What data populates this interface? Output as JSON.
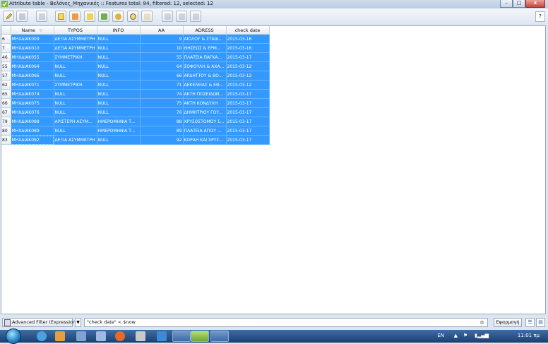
{
  "window": {
    "title": "Attribute table - Βελόνες_Μηχανικές :: Features total: 84, filtered: 12, selected: 12",
    "minimize": "–",
    "maximize": "□",
    "close": "x"
  },
  "toolbar": {
    "buttons": [
      "toggle-editing",
      "save-edits",
      "delete-selected",
      "expression-select",
      "invert-selection",
      "unselect-all",
      "move-selection-top",
      "pan-to-selected",
      "zoom-to-selected",
      "copy-rows",
      "paste-rows",
      "new-column",
      "delete-column",
      "field-calculator"
    ],
    "help": "?"
  },
  "table": {
    "columns": [
      "Name",
      "TYPOS",
      "INFO",
      "AA",
      "ADRESS",
      "check date"
    ],
    "rows": [
      {
        "id": "6",
        "cells": [
          "ΜΗΧΔΙΑΚ009",
          "ΔΕΞΙΑ ΑΣΥΜΜΕΤΡΗ",
          "NULL",
          "9",
          "ΑΙΟΛΟΥ & ΣΤΑΔΙ...",
          "2015-03-16"
        ]
      },
      {
        "id": "7",
        "cells": [
          "ΜΗΧΔΙΑΚ010",
          "ΔΕΞΙΑ ΑΣΥΜΜΕΤΡΗ",
          "NULL",
          "10",
          "ΘΗΣΕΩΣ & ΕΡΜ...",
          "2015-03-16"
        ]
      },
      {
        "id": "46",
        "cells": [
          "ΜΗΧΔΙΑΚ055",
          "ΣΥΜΜΕΤΡΙΚΗ",
          "NULL",
          "55",
          "ΠΛΑΤΕΙΑ ΠΑΓΚΑ...",
          "2015-03-17"
        ]
      },
      {
        "id": "55",
        "cells": [
          "ΜΗΧΔΙΑΚ064",
          "NULL",
          "NULL",
          "64",
          "ΣΟΦΟΥΛΗ & ΑΧΑ...",
          "2015-03-12"
        ]
      },
      {
        "id": "57",
        "cells": [
          "ΜΗΧΔΙΑΚ066",
          "NULL",
          "NULL",
          "66",
          "ΑΡΔΗΤΤΟΥ & ΒΟ...",
          "2015-03-12"
        ]
      },
      {
        "id": "62",
        "cells": [
          "ΜΗΧΔΙΑΚ071",
          "ΣΥΜΜΕΤΡΙΚΗ",
          "NULL",
          "71",
          "ΔΕΚΕΛΕΙΑΣ & ΕΘ...",
          "2015-03-12"
        ]
      },
      {
        "id": "65",
        "cells": [
          "ΜΗΧΔΙΑΚ074",
          "NULL",
          "NULL",
          "74",
          "ΑΚΤΗ ΠΟΣΕΙΔΩΝ...",
          "2015-03-17"
        ]
      },
      {
        "id": "66",
        "cells": [
          "ΜΗΧΔΙΑΚ075",
          "NULL",
          "NULL",
          "75",
          "ΑΚΤΗ ΚΟΝΔΥΛΗ",
          "2015-03-17"
        ]
      },
      {
        "id": "67",
        "cells": [
          "ΜΗΧΔΙΑΚ076",
          "NULL",
          "NULL",
          "76",
          "ΔΗΜΗΤΡΙΟΥ ΓΟΥ...",
          "2015-03-17"
        ]
      },
      {
        "id": "79",
        "cells": [
          "ΜΗΧΔΙΑΚ088",
          "ΑΡΙΣΤΕΡΗ ΑΣΥΜ...",
          "ΗΜΕΡΟΜΗΝΙΑ Τ...",
          "88",
          "ΧΡΥΣΟΣΤΟΜΟΥ Σ...",
          "2015-03-17"
        ]
      },
      {
        "id": "80",
        "cells": [
          "ΜΗΧΔΙΑΚ089",
          "NULL",
          "ΗΜΕΡΟΜΗΝΙΑ Τ...",
          "89",
          "ΠΛΑΤΕΙΑ ΑΓΙΟΥ ...",
          "2015-03-17"
        ]
      },
      {
        "id": "83",
        "cells": [
          "ΜΗΧΔΙΑΚ092",
          "ΔΕΞΙΑ ΑΣΥΜΜΕΤΡΗ",
          "NULL",
          "92",
          "ΚΟΡΑΗ ΚΑΙ ΧΡΥΣ...",
          "2015-03-17"
        ]
      }
    ]
  },
  "filter": {
    "mode_label": "Advanced Filter (Expression)",
    "expression": "\"check date\" < $now",
    "clear_icon": "⊗",
    "apply_label": "Εφαρμογή"
  },
  "taskbar": {
    "language": "EN",
    "clock": "11:01 πμ"
  },
  "colors": {
    "selection": "#3399ff",
    "taskbar": "#1c3f6e"
  }
}
